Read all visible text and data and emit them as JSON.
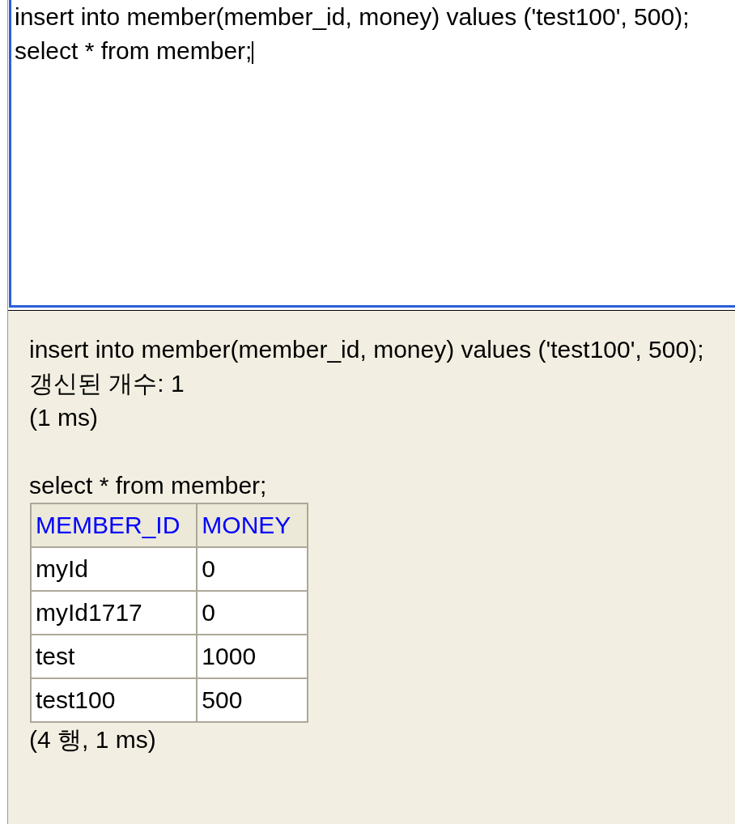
{
  "editor": {
    "focused": true,
    "value": "insert into member(member_id, money) values ('test100', 500);\nselect * from member;"
  },
  "results": [
    {
      "kind": "update",
      "statement": "insert into member(member_id, money) values ('test100', 500);",
      "message": "갱신된 개수: 1",
      "timing": "(1 ms)"
    },
    {
      "kind": "query",
      "statement": "select * from member;",
      "table": {
        "columns": [
          "MEMBER_ID",
          "MONEY"
        ],
        "rows": [
          [
            "myId",
            "0"
          ],
          [
            "myId1717",
            "0"
          ],
          [
            "test",
            "1000"
          ],
          [
            "test100",
            "500"
          ]
        ]
      },
      "timing": "(4 행, 1 ms)"
    }
  ]
}
